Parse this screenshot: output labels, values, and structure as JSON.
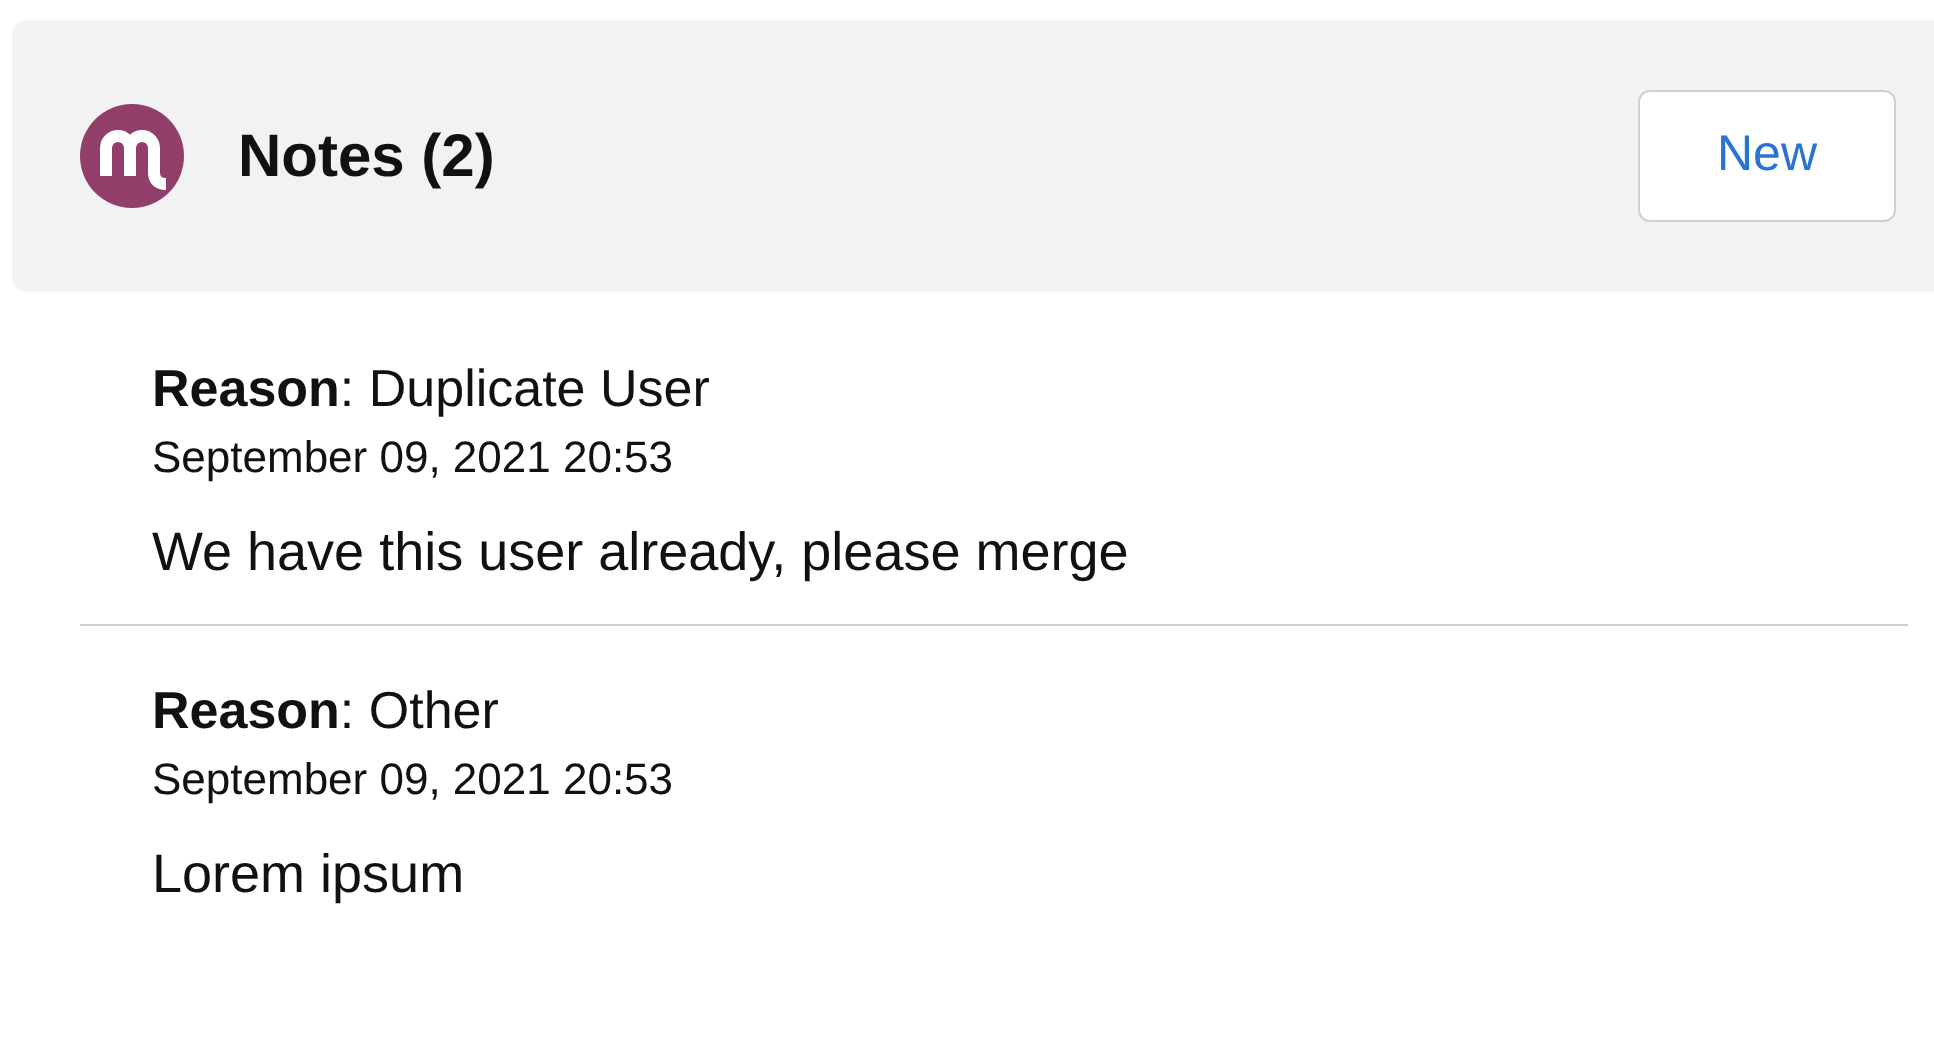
{
  "header": {
    "title": "Notes (2)",
    "new_button": "New"
  },
  "notes": [
    {
      "reason": "**Reason**: Duplicate User",
      "date": "September 09, 2021 20:53",
      "body": "We have this user already, please merge"
    },
    {
      "reason": "**Reason**: Other",
      "date": "September 09, 2021 20:53",
      "body": "Lorem ipsum"
    }
  ]
}
